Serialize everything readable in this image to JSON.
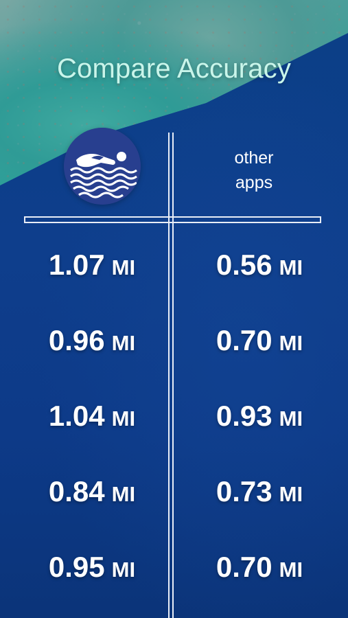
{
  "title": "Compare Accuracy",
  "columns": {
    "left_icon": "swimmer-waves-logo-icon",
    "right_label": "other\napps"
  },
  "unit": "MI",
  "rows": [
    {
      "left": "1.07",
      "right": "0.56"
    },
    {
      "left": "0.96",
      "right": "0.70"
    },
    {
      "left": "1.04",
      "right": "0.93"
    },
    {
      "left": "0.84",
      "right": "0.73"
    },
    {
      "left": "0.95",
      "right": "0.70"
    }
  ],
  "colors": {
    "title": "#c9f5ea",
    "background": "#0f3a86",
    "logo_circle": "#283f8f",
    "lines": "#e9eef7",
    "text": "#ffffff"
  }
}
